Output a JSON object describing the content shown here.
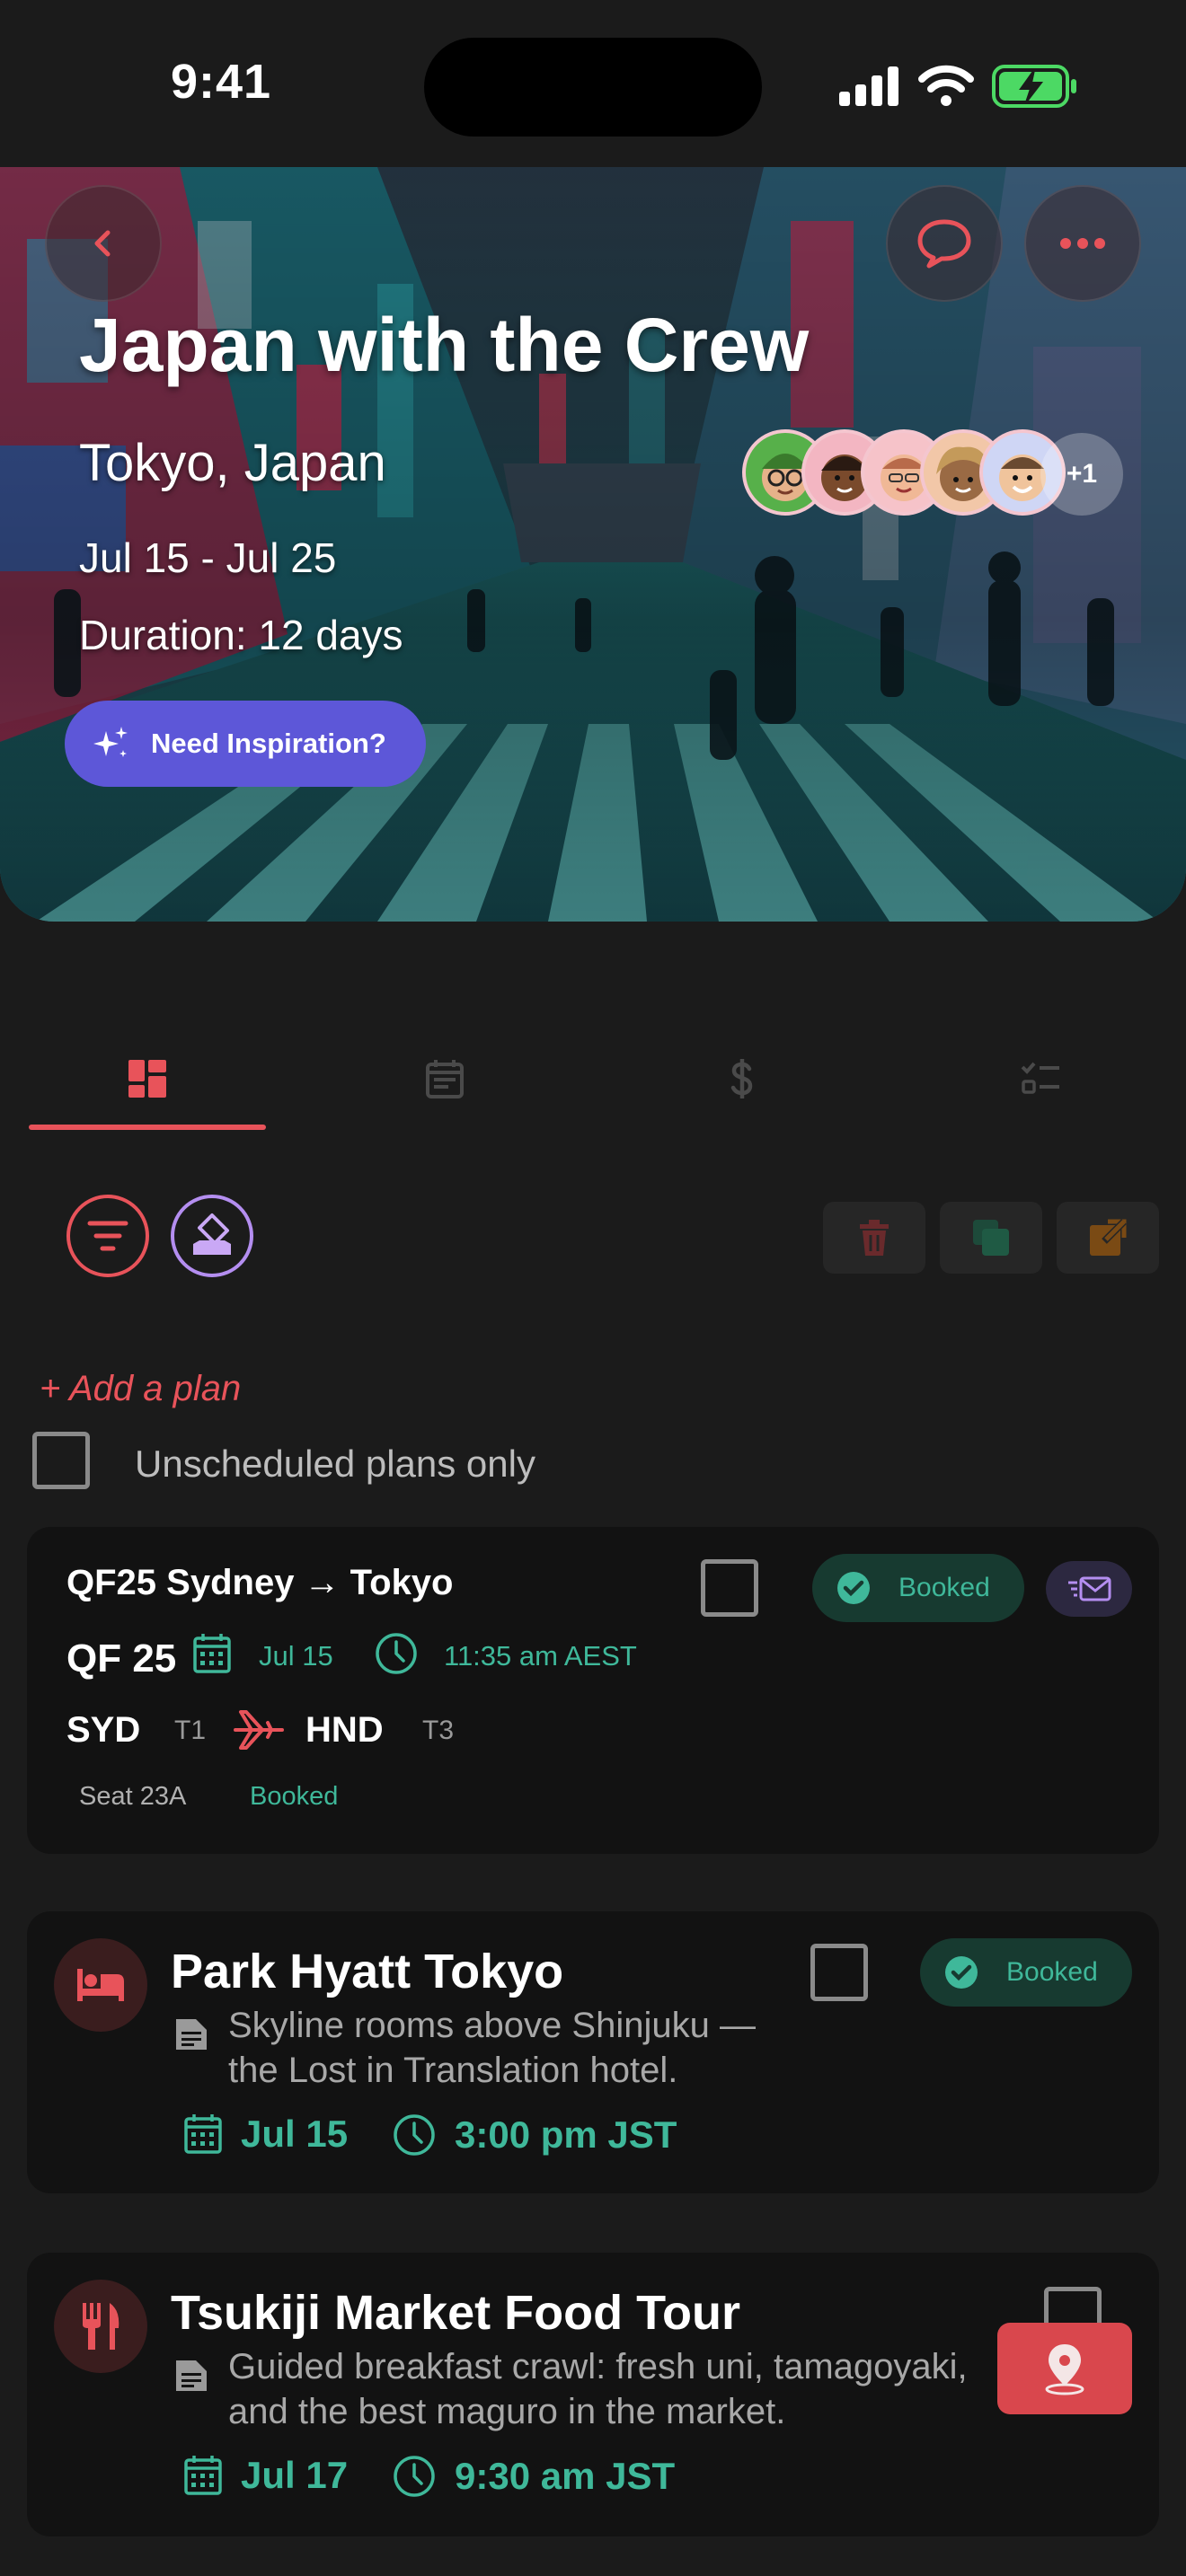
{
  "status_bar": {
    "time": "9:41"
  },
  "trip": {
    "title": "Japan with the Crew",
    "location": "Tokyo, Japan",
    "dates": "Jul 15 - Jul 25",
    "duration": "Duration: 12 days",
    "inspiration_button": "Need Inspiration?",
    "extra_members": "+1"
  },
  "filters": {
    "add_plan": "+ Add a plan",
    "unscheduled_label": "Unscheduled plans only"
  },
  "flight": {
    "title": "QF25 Sydney → Tokyo",
    "flight_number": "QF 25",
    "date": "Jul 15",
    "time": "11:35 am AEST",
    "from_code": "SYD",
    "from_terminal": "T1",
    "to_code": "HND",
    "to_terminal": "T3",
    "seat": "Seat 23A",
    "seat_status": "Booked",
    "status": "Booked"
  },
  "plans": [
    {
      "title": "Park Hyatt Tokyo",
      "description": "Skyline rooms above Shinjuku — the Lost in Translation hotel.",
      "date": "Jul 15",
      "time": "3:00 pm JST",
      "status": "Booked",
      "icon": "bed-icon"
    },
    {
      "title": "Tsukiji Market Food Tour",
      "description": "Guided breakfast crawl: fresh uni, tamagoyaki, and the best maguro in the market.",
      "date": "Jul 17",
      "time": "9:30 am JST",
      "icon": "fork-knife-icon"
    }
  ],
  "colors": {
    "accent": "#e8535a",
    "green": "#3fb89a",
    "purple": "#5d57d8",
    "background": "#1b1b1b",
    "card": "#121212"
  }
}
